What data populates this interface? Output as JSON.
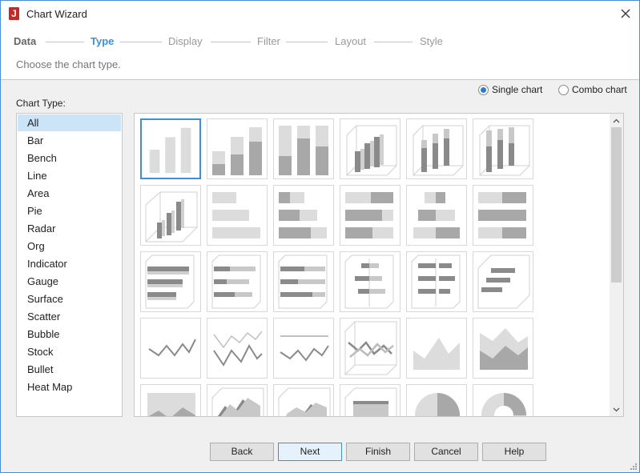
{
  "window": {
    "title": "Chart Wizard",
    "app_icon_letter": "J"
  },
  "steps": [
    {
      "label": "Data",
      "state": "done"
    },
    {
      "label": "Type",
      "state": "active"
    },
    {
      "label": "Display",
      "state": "pending"
    },
    {
      "label": "Filter",
      "state": "pending"
    },
    {
      "label": "Layout",
      "state": "pending"
    },
    {
      "label": "Style",
      "state": "pending"
    }
  ],
  "hint": "Choose the chart type.",
  "mode": {
    "single_label": "Single chart",
    "combo_label": "Combo chart",
    "selected": "single"
  },
  "chart_type_label": "Chart Type:",
  "chart_types": [
    "All",
    "Bar",
    "Bench",
    "Line",
    "Area",
    "Pie",
    "Radar",
    "Org",
    "Indicator",
    "Gauge",
    "Surface",
    "Scatter",
    "Bubble",
    "Stock",
    "Bullet",
    "Heat Map"
  ],
  "selected_chart_type": "All",
  "buttons": {
    "back": "Back",
    "next": "Next",
    "finish": "Finish",
    "cancel": "Cancel",
    "help": "Help"
  },
  "colors": {
    "accent": "#3f8fd8",
    "selection": "#cce4f7",
    "border_accent": "#4a8fd6"
  }
}
